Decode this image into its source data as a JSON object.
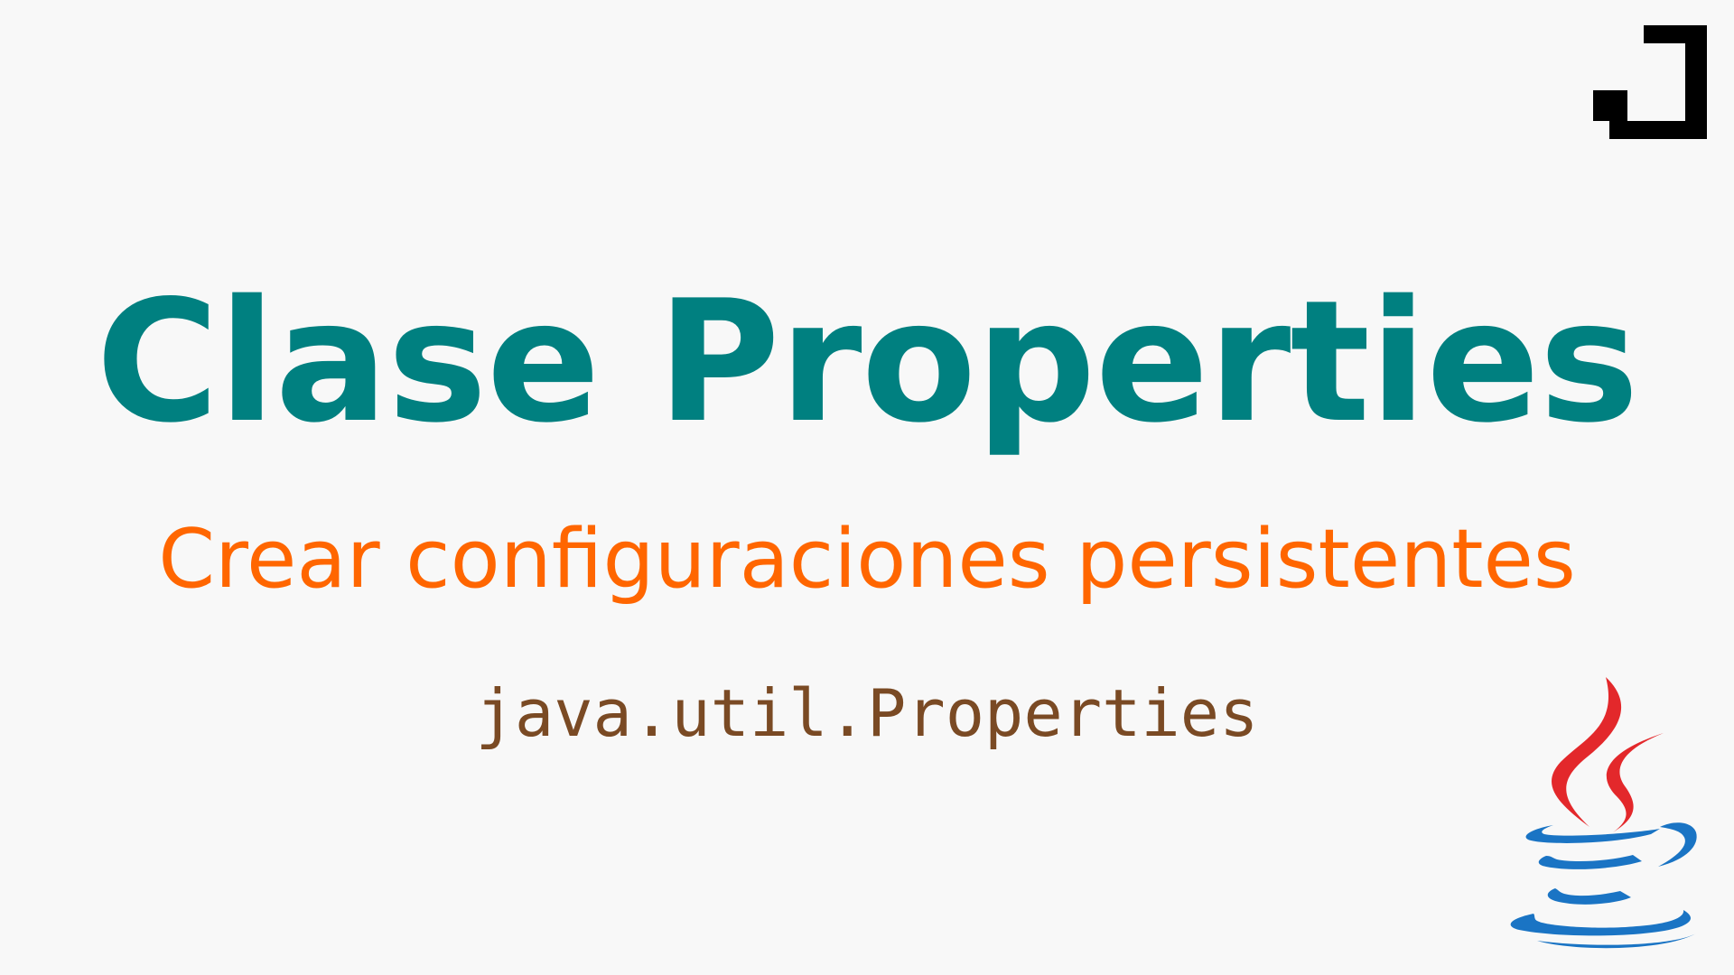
{
  "title": "Clase Properties",
  "subtitle": "Crear configuraciones persistentes",
  "package": "java.util.Properties",
  "icons": {
    "brand_logo": "bracket-logo-icon",
    "java_logo": "java-coffee-cup-icon"
  },
  "colors": {
    "background": "#f8f8f8",
    "title": "#008080",
    "subtitle": "#ff6600",
    "package": "#7a4a24",
    "java_blue": "#1a74c4",
    "java_red": "#e3282b",
    "logo_black": "#000000"
  }
}
